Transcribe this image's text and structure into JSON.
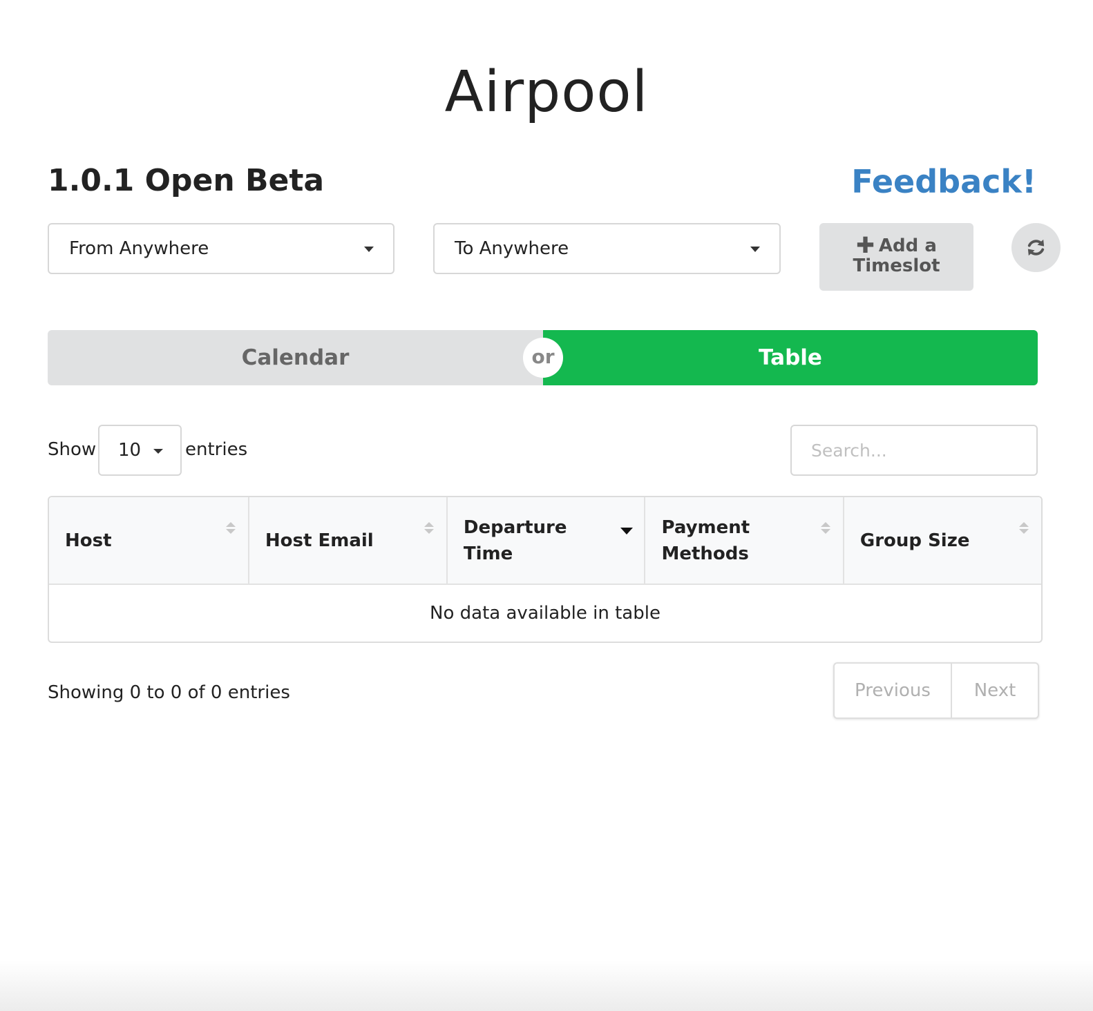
{
  "app": {
    "title": "Airpool",
    "version": "1.0.1 Open Beta",
    "feedback_label": "Feedback!"
  },
  "filters": {
    "from_label": "From Anywhere",
    "to_label": "To Anywhere",
    "add_button_label": "Add a Timeslot",
    "add_button_icon": "plus-icon",
    "refresh_icon": "refresh-icon"
  },
  "view_toggle": {
    "calendar_label": "Calendar",
    "or_label": "or",
    "table_label": "Table",
    "active": "Table",
    "active_color": "#14b84f"
  },
  "table_controls": {
    "show_label": "Show",
    "page_length": "10",
    "entries_label": "entries",
    "search_placeholder": "Search..."
  },
  "table": {
    "columns": [
      {
        "label": "Host",
        "sort": "none"
      },
      {
        "label": "Host Email",
        "sort": "none"
      },
      {
        "label": "Departure Time",
        "sort": "desc"
      },
      {
        "label": "Payment Methods",
        "sort": "none"
      },
      {
        "label": "Group Size",
        "sort": "none"
      }
    ],
    "empty_message": "No data available in table"
  },
  "footer": {
    "info": "Showing 0 to 0 of 0 entries",
    "previous_label": "Previous",
    "next_label": "Next"
  },
  "colors": {
    "feedback_link": "#3a82c4",
    "toggle_inactive": "#e0e1e2"
  }
}
